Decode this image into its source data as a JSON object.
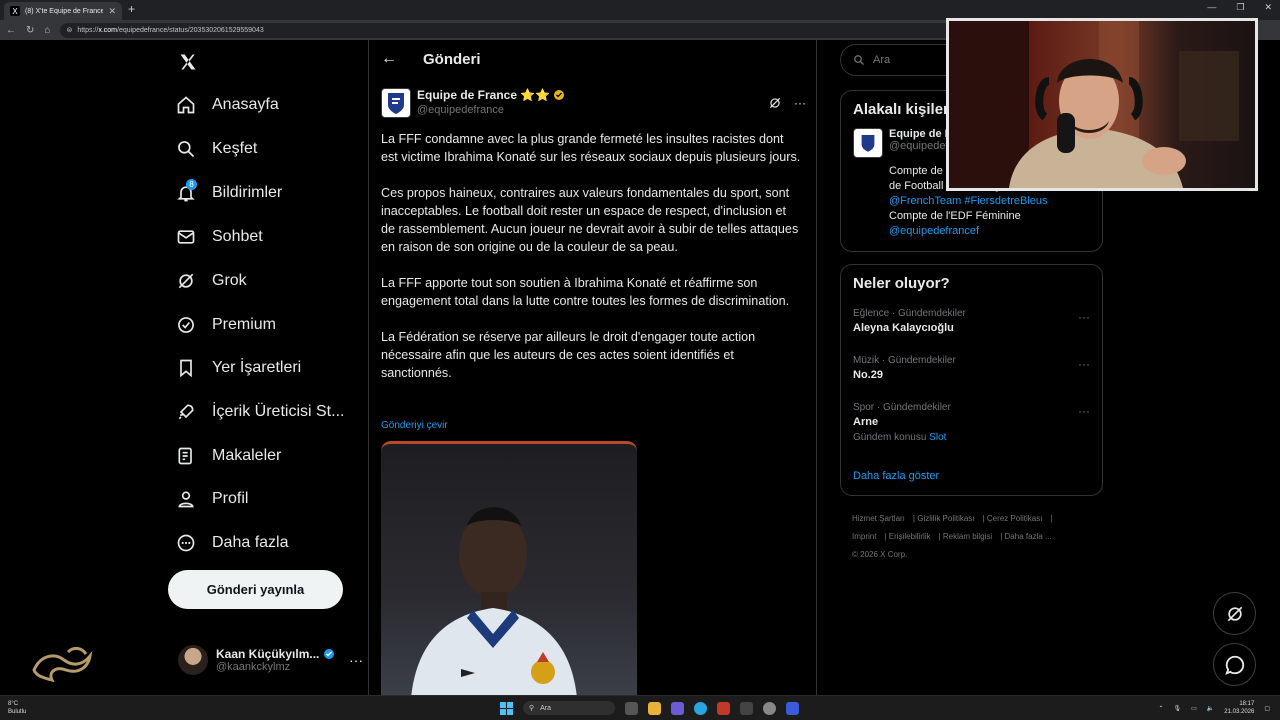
{
  "browser": {
    "tab_title": "(8) X'te Equipe de France ⭐⭐ ...",
    "url_prefix": "https://",
    "url_host": "x.com",
    "url_path": "/equipedefrance/status/2035302061529559043"
  },
  "sidebar": {
    "items": [
      {
        "label": "Anasayfa",
        "icon": "home-icon"
      },
      {
        "label": "Keşfet",
        "icon": "search-icon"
      },
      {
        "label": "Bildirimler",
        "icon": "bell-icon",
        "badge": "8"
      },
      {
        "label": "Sohbet",
        "icon": "mail-icon"
      },
      {
        "label": "Grok",
        "icon": "grok-icon"
      },
      {
        "label": "Premium",
        "icon": "premium-icon"
      },
      {
        "label": "Yer İşaretleri",
        "icon": "bookmark-icon"
      },
      {
        "label": "İçerik Üreticisi St...",
        "icon": "rocket-icon"
      },
      {
        "label": "Makaleler",
        "icon": "article-icon"
      },
      {
        "label": "Profil",
        "icon": "profile-icon"
      },
      {
        "label": "Daha fazla",
        "icon": "more-circle-icon"
      }
    ],
    "post_button": "Gönderi yayınla",
    "account": {
      "name": "Kaan Küçükyılm...",
      "handle": "@kaankckylmz"
    }
  },
  "main": {
    "header_title": "Gönderi",
    "author_name": "Equipe de France ⭐⭐",
    "author_handle": "@equipedefrance",
    "paragraphs": [
      "La FFF condamne avec la plus grande fermeté les insultes racistes dont est victime Ibrahima Konaté sur les réseaux sociaux depuis plusieurs jours.",
      "Ces propos haineux, contraires aux valeurs fondamentales du sport, sont inacceptables. Le football doit rester un espace de respect, d'inclusion et de rassemblement. Aucun joueur ne devrait avoir à subir de telles attaques en raison de son origine ou de la couleur de sa peau.",
      "La FFF apporte tout son soutien à Ibrahima Konaté et réaffirme son engagement total dans la lutte contre toutes les formes de discrimination.",
      "La Fédération se réserve par ailleurs le droit d'engager toute action nécessaire afin que les auteurs de ces actes soient identifiés et sanctionnés."
    ],
    "translate_link": "Gönderiyi çevir"
  },
  "right": {
    "search_placeholder": "Ara",
    "related_title": "Alakalı kişiler",
    "related": {
      "name": "Equipe de France",
      "handle": "@equipedefrance",
      "bio_1": "Compte de l'Equipe de France masculine de Football Twitter anglais",
      "bio_tags": "@FrenchTeam #FiersdetreBleus",
      "bio_2": "Compte de l'EDF Féminine",
      "bio_link": "@equipedefrancef"
    },
    "trends_title": "Neler oluyor?",
    "trends": [
      {
        "category": "Eğlence · Gündemdekiler",
        "name": "Aleyna Kalaycıoğlu",
        "sub": "",
        "sub_link": ""
      },
      {
        "category": "Müzik · Gündemdekiler",
        "name": "No.29",
        "sub": "",
        "sub_link": ""
      },
      {
        "category": "Spor · Gündemdekiler",
        "name": "Arne",
        "sub": "Gündem konusu",
        "sub_link": "Slot"
      }
    ],
    "show_more": "Daha fazla göster",
    "footer_links": [
      "Hizmet Şartları",
      "Gizlilik Politikası",
      "Çerez Politikası",
      "Imprint",
      "Erişilebilirlik",
      "Reklam bilgisi",
      "Daha fazla ..."
    ],
    "copyright": "© 2026 X Corp."
  },
  "taskbar": {
    "weather_temp": "8°C",
    "weather_desc": "Bulutlu",
    "search_label": "Ara",
    "time": "18:17",
    "date": "21.03.2026"
  }
}
